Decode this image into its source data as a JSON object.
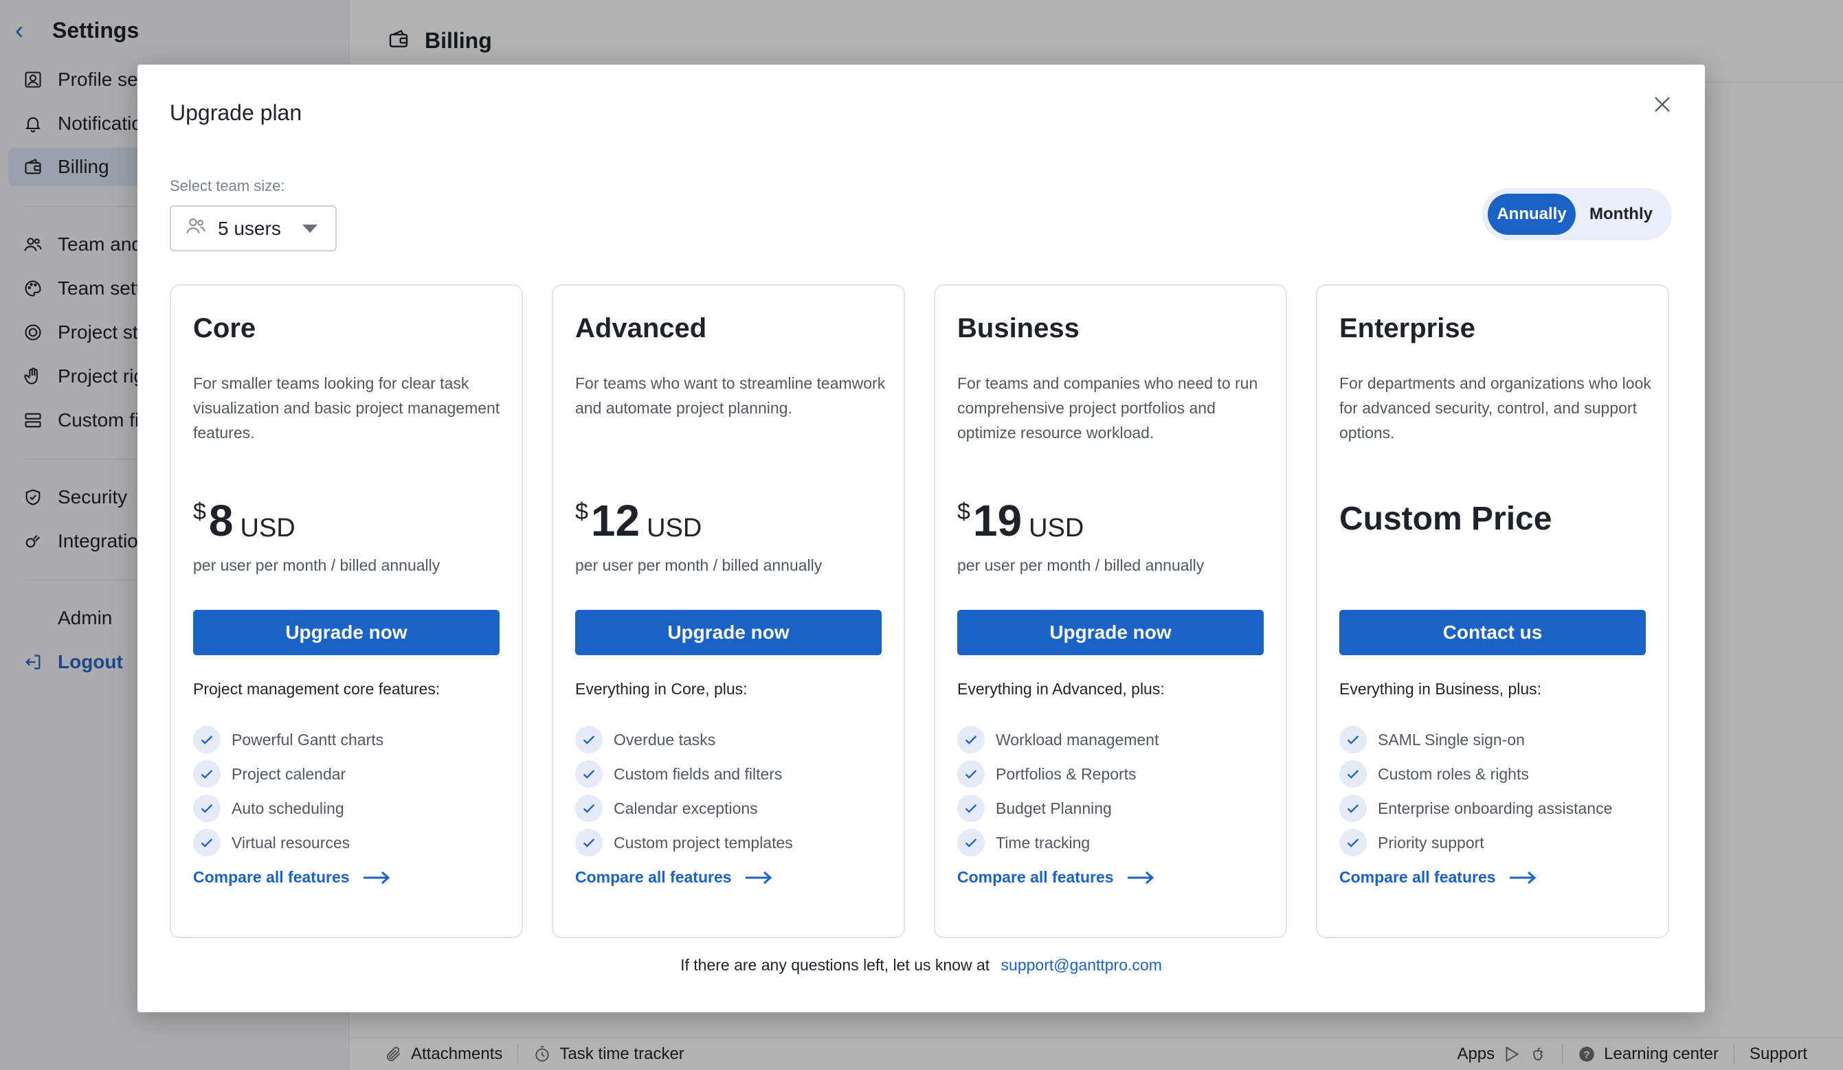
{
  "sidebar": {
    "title": "Settings",
    "items": [
      {
        "label": "Profile settings",
        "icon": "profile-icon"
      },
      {
        "label": "Notifications",
        "icon": "bell-icon"
      },
      {
        "label": "Billing",
        "icon": "wallet-icon",
        "active": true
      },
      {
        "label": "Team and resources",
        "icon": "team-icon"
      },
      {
        "label": "Team settings",
        "icon": "palette-icon"
      },
      {
        "label": "Project statuses",
        "icon": "status-icon"
      },
      {
        "label": "Project rights",
        "icon": "hand-icon"
      },
      {
        "label": "Custom fields",
        "icon": "fields-icon"
      },
      {
        "label": "Security",
        "icon": "shield-icon"
      },
      {
        "label": "Integrations",
        "icon": "integration-icon"
      }
    ],
    "admin_label": "Admin",
    "logout_label": "Logout"
  },
  "topbar": {
    "title": "Billing"
  },
  "bottombar": {
    "attachments": "Attachments",
    "time_tracker": "Task time tracker",
    "apps": "Apps",
    "learning": "Learning center",
    "support": "Support"
  },
  "modal": {
    "title": "Upgrade plan",
    "team_size_label": "Select team size:",
    "team_size_value": "5 users",
    "toggle": {
      "annually": "Annually",
      "monthly": "Monthly",
      "selected": "Annually"
    },
    "footer_text": "If there are any questions left, let us know at",
    "footer_email": "support@ganttpro.com"
  },
  "plans": [
    {
      "name": "Core",
      "description": "For smaller teams looking for clear task visualization and basic project management features.",
      "currency": "$",
      "price": "8",
      "unit": "USD",
      "price_note": "per user per month / billed annually",
      "cta": "Upgrade now",
      "features_heading": "Project management core features:",
      "features": [
        "Powerful Gantt charts",
        "Project calendar",
        "Auto scheduling",
        "Virtual resources"
      ],
      "compare": "Compare all features"
    },
    {
      "name": "Advanced",
      "description": "For teams who want to streamline teamwork and automate project planning.",
      "currency": "$",
      "price": "12",
      "unit": "USD",
      "price_note": "per user per month / billed annually",
      "cta": "Upgrade now",
      "features_heading": "Everything in Core, plus:",
      "features": [
        "Overdue tasks",
        "Custom fields and filters",
        "Calendar exceptions",
        "Custom project templates"
      ],
      "compare": "Compare all features"
    },
    {
      "name": "Business",
      "description": "For teams and companies who need to run comprehensive project portfolios and optimize resource workload.",
      "currency": "$",
      "price": "19",
      "unit": "USD",
      "price_note": "per user per month / billed annually",
      "cta": "Upgrade now",
      "features_heading": "Everything in Advanced, plus:",
      "features": [
        "Workload management",
        "Portfolios & Reports",
        "Budget Planning",
        "Time tracking"
      ],
      "compare": "Compare all features"
    },
    {
      "name": "Enterprise",
      "description": "For departments and organizations who look for advanced security, control, and support options.",
      "custom_price": "Custom Price",
      "cta": "Contact us",
      "features_heading": "Everything in Business, plus:",
      "features": [
        "SAML Single sign-on",
        "Custom roles & rights",
        "Enterprise onboarding assistance",
        "Priority support"
      ],
      "compare": "Compare all features"
    }
  ],
  "colors": {
    "accent": "#1b62c7",
    "check_bg": "#e4ebf7",
    "overlay": "rgba(0,0,0,0.30)"
  }
}
